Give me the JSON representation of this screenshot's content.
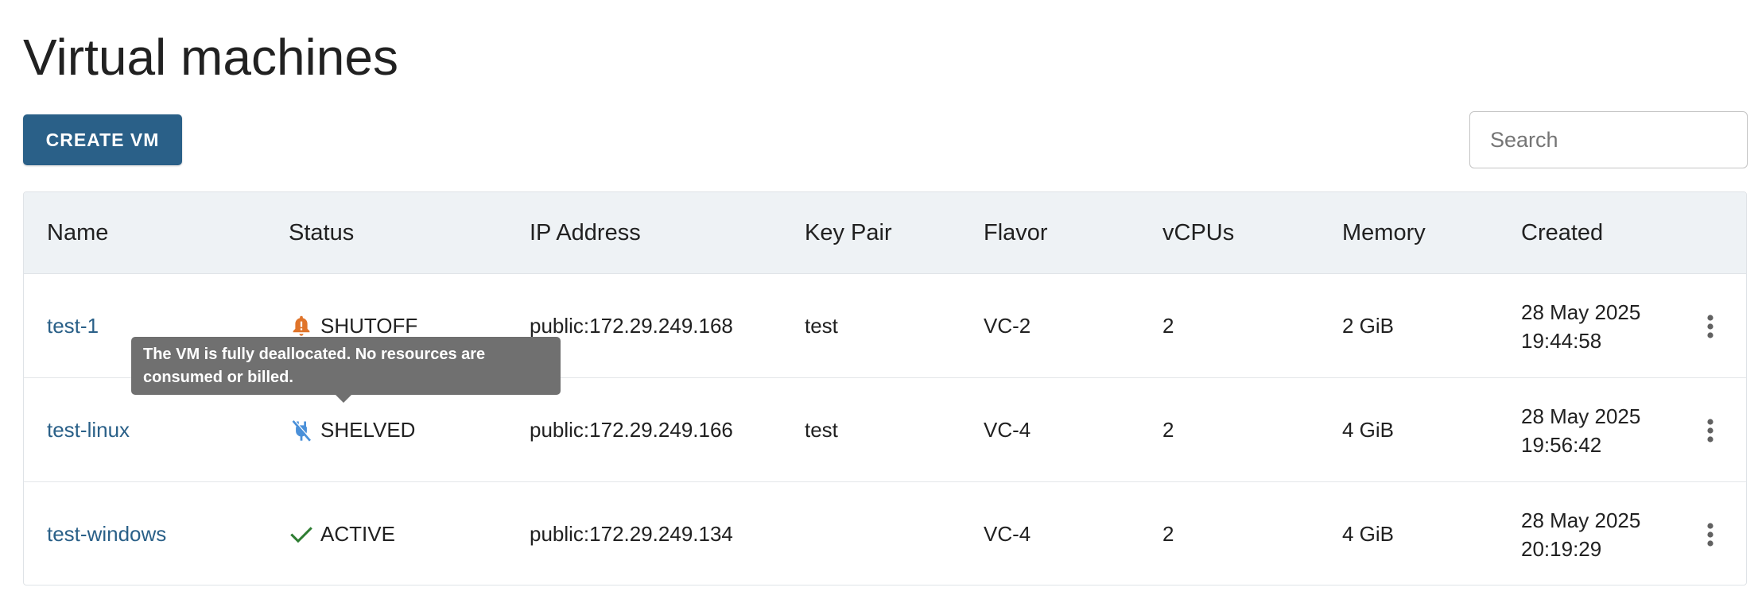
{
  "page": {
    "title": "Virtual machines"
  },
  "toolbar": {
    "create_label": "CREATE VM",
    "search_placeholder": "Search",
    "search_value": ""
  },
  "table": {
    "headers": {
      "name": "Name",
      "status": "Status",
      "ip": "IP Address",
      "keypair": "Key Pair",
      "flavor": "Flavor",
      "vcpus": "vCPUs",
      "memory": "Memory",
      "created": "Created"
    },
    "rows": [
      {
        "name": "test-1",
        "status": "SHUTOFF",
        "status_icon": "alert-bell-icon",
        "status_color": "#e0742a",
        "ip": "public:172.29.249.168",
        "keypair": "test",
        "flavor": "VC-2",
        "vcpus": "2",
        "memory": "2 GiB",
        "created_date": "28 May 2025",
        "created_time": "19:44:58"
      },
      {
        "name": "test-linux",
        "status": "SHELVED",
        "status_icon": "power-off-icon",
        "status_color": "#4a90d9",
        "ip": "public:172.29.249.166",
        "keypair": "test",
        "flavor": "VC-4",
        "vcpus": "2",
        "memory": "4 GiB",
        "created_date": "28 May 2025",
        "created_time": "19:56:42"
      },
      {
        "name": "test-windows",
        "status": "ACTIVE",
        "status_icon": "check-icon",
        "status_color": "#2e7d32",
        "ip": "public:172.29.249.134",
        "keypair": "",
        "flavor": "VC-4",
        "vcpus": "2",
        "memory": "4 GiB",
        "created_date": "28 May 2025",
        "created_time": "20:19:29"
      }
    ]
  },
  "tooltip": {
    "line1": "The VM is fully deallocated. No resources are",
    "line2": "consumed or billed."
  },
  "colors": {
    "primary": "#2a6088",
    "header_bg": "#eef2f5",
    "tooltip_bg": "#707070"
  }
}
